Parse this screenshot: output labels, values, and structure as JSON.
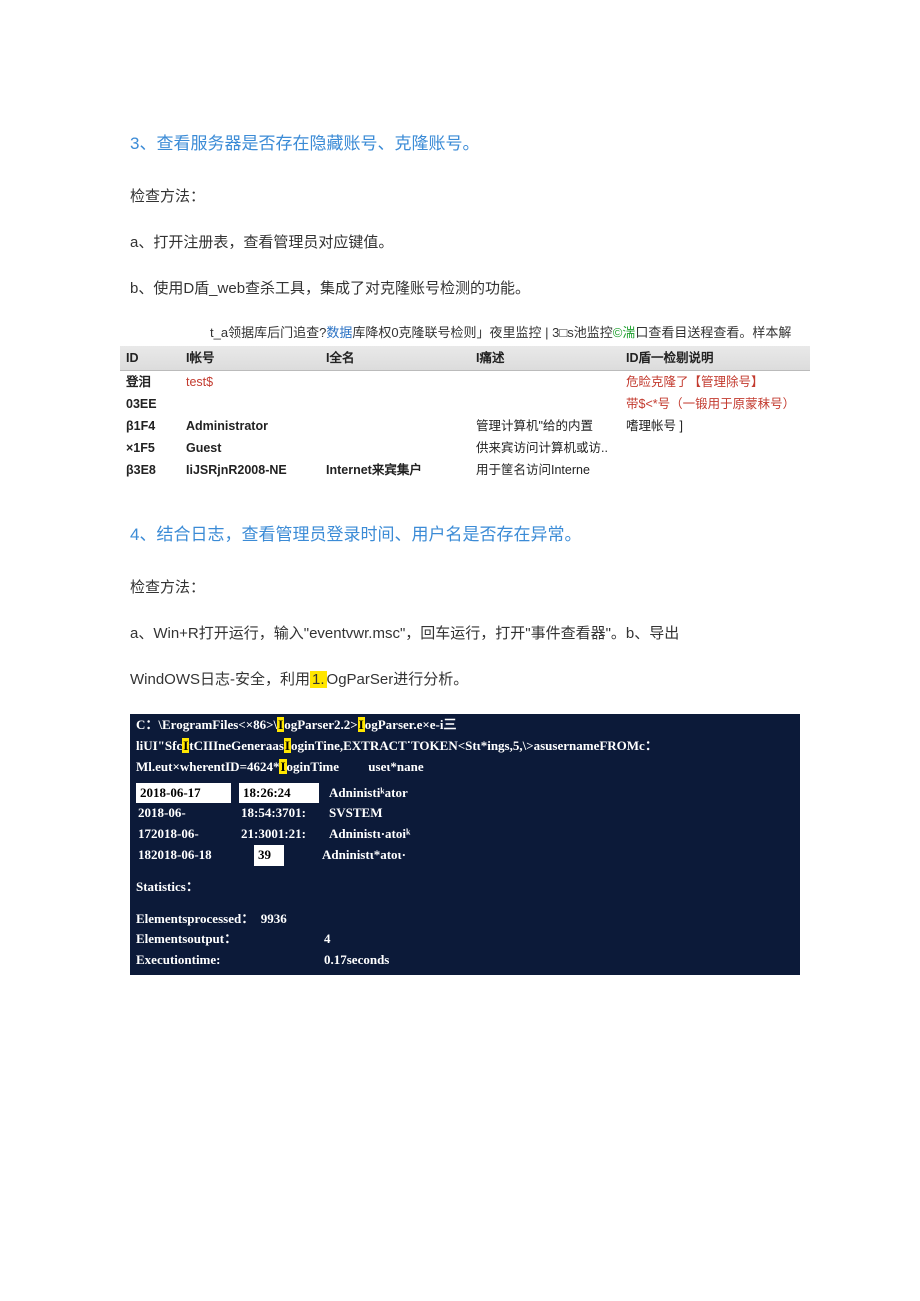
{
  "section3": {
    "heading": "3、查看服务器是否存在隐藏账号、克隆账号。",
    "p1": "检查方法：",
    "p2": "a、打开注册表，查看管理员对应键值。",
    "p3": "b、使用D盾_web查杀工具，集成了对克隆账号检测的功能。"
  },
  "ddun": {
    "caption_parts": {
      "a": "t_a领据库后门追查?",
      "b": "数据",
      "c": "库降权0克隆联号检则」夜里监控 | 3□s池监控",
      "d": "©湍",
      "e": "口查看目送程查看。样本解"
    },
    "headers": [
      "ID",
      "I帐号",
      "I全名",
      "I痛述",
      "ID盾一检剔说明"
    ],
    "rows": [
      {
        "id": "登泪",
        "acct": "test$",
        "full": "",
        "desc": "",
        "note": "危睑克隆了【管理除号】"
      },
      {
        "id": "03EE",
        "acct": "",
        "full": "",
        "desc": "",
        "note": "带$<*号（一锻用于原蒙秣号）"
      },
      {
        "id": "β1F4",
        "acct": "Administrator",
        "full": "",
        "desc": "管理计算机\"给的内置",
        "note": "嗜理帐号 ]"
      },
      {
        "id": "×1F5",
        "acct": "Guest",
        "full": "",
        "desc": "供来宾访问计算机或访..",
        "note": ""
      },
      {
        "id": "β3E8",
        "acct": "IiJSRjnR2008-NE",
        "full": "Internet来宾集户",
        "desc": "用于筐名访问Interne",
        "note": ""
      }
    ]
  },
  "section4": {
    "heading": "4、结合日志，查看管理员登录时间、用户名是否存在异常。",
    "p1": "检查方法：",
    "p2": "a、Win+R打开运行，输入\"eventvwr.msc\"，回车运行，打开\"事件查看器\"。b、导出",
    "p3_a": "WindOWS日志-安全，利用",
    "p3_hl": "1.",
    "p3_b": "OgParSer进行分析。"
  },
  "term": {
    "cmd1_a": "C：\\ErogramFiles<×86>\\",
    "cmd1_h1": "I",
    "cmd1_b": "ogParser2.2>",
    "cmd1_h2": "I",
    "cmd1_c": "ogParser.e×e-i三liUI\"Sfc",
    "cmd1_h3": "I",
    "cmd1_d": "tCIIIneGeneraas",
    "cmd1_h4": "I",
    "cmd1_e": "oginTine,EXTRACT˙TOKEN<Stι*ings,5,\\>asusernameFROMc：Ml.eut×wherentID=4624*",
    "cmd1_h5": "I",
    "header_cells": [
      "oginTime",
      "",
      "useι*nane"
    ],
    "rows": [
      {
        "c1": "2018-06-17",
        "c2": "18:26:24",
        "c3": "Adninistiᵏator",
        "inv": true
      },
      {
        "c1": "2018-06-",
        "c2": "18:54:3701:",
        "c3": "SVSTEM",
        "inv": false
      },
      {
        "c1": "172018-06-",
        "c2": "21:3001:21:",
        "c3": "Adninistι·atoiᵏ",
        "inv": false
      },
      {
        "c1": "182018-06-18",
        "c2": "39",
        "c3": "Adninistι*atoι·",
        "inv": false
      }
    ],
    "stats_label": "Statistics：",
    "stats": [
      {
        "k": "Elementsprocessed：",
        "v": "9936",
        "pad": ""
      },
      {
        "k": "Elementsoutput：",
        "v": "",
        "pad": "4"
      },
      {
        "k": "Executiontime:",
        "v": "",
        "pad": "0.17seconds"
      }
    ]
  }
}
